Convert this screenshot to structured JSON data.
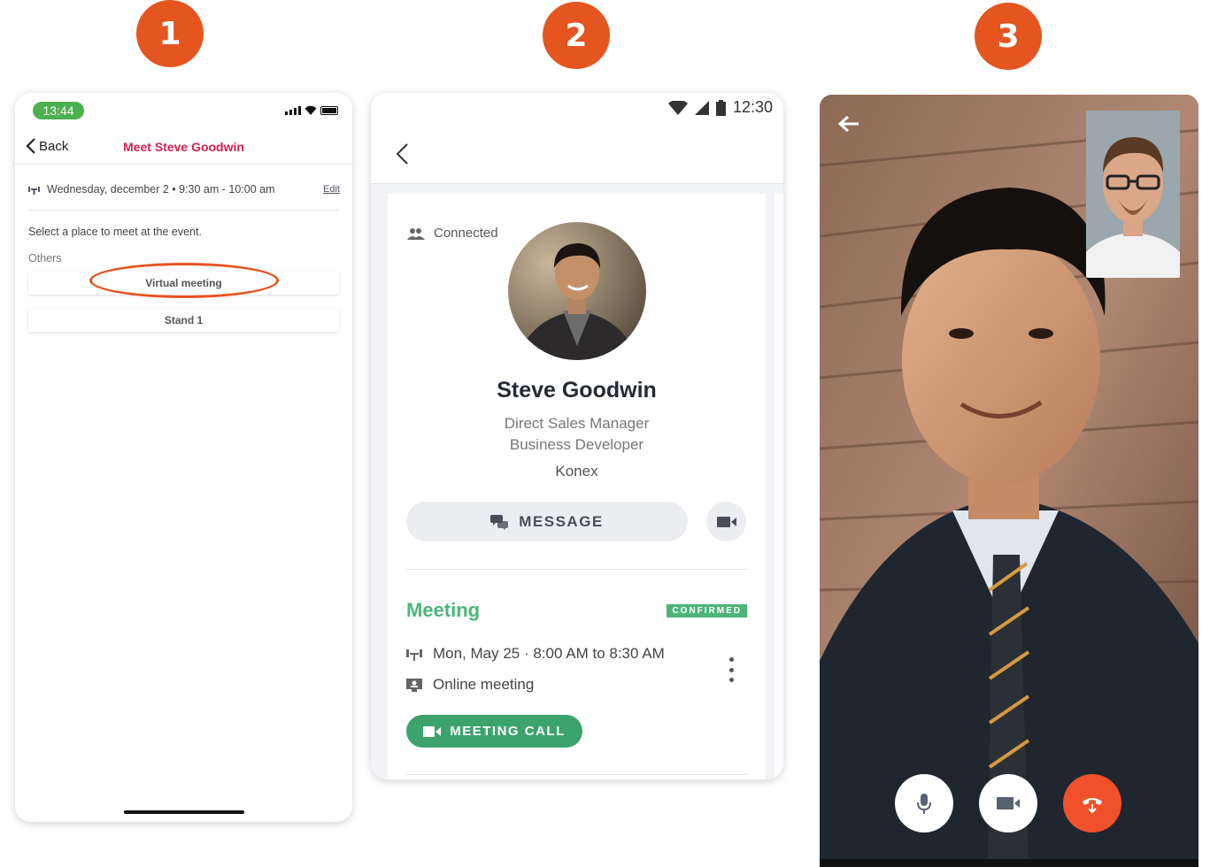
{
  "steps": [
    "1",
    "2",
    "3"
  ],
  "screen1": {
    "status_time": "13:44",
    "back_label": "Back",
    "title": "Meet Steve Goodwin",
    "date_text": "Wednesday, december 2 • 9:30 am - 10:00 am",
    "edit_label": "Edit",
    "instruction": "Select a place to meet at the event.",
    "section_label": "Others",
    "options": [
      "Virtual meeting",
      "Stand 1"
    ]
  },
  "screen2": {
    "status_time": "12:30",
    "connection_label": "Connected",
    "name": "Steve Goodwin",
    "role_line1": "Direct Sales Manager",
    "role_line2": "Business Developer",
    "company": "Konex",
    "message_label": "MESSAGE",
    "meeting_title": "Meeting",
    "meeting_status": "CONFIRMED",
    "meeting_datetime": "Mon, May 25 · 8:00 AM to 8:30 AM",
    "meeting_location": "Online meeting",
    "call_label": "MEETING CALL",
    "colors": {
      "green": "#4cb57a",
      "accent_red": "#d8204f",
      "step_orange": "#e4551f"
    }
  },
  "screen3": {
    "icons": [
      "back-arrow-icon",
      "microphone-icon",
      "video-camera-icon",
      "hang-up-icon"
    ],
    "end_call_color": "#f0502a"
  }
}
